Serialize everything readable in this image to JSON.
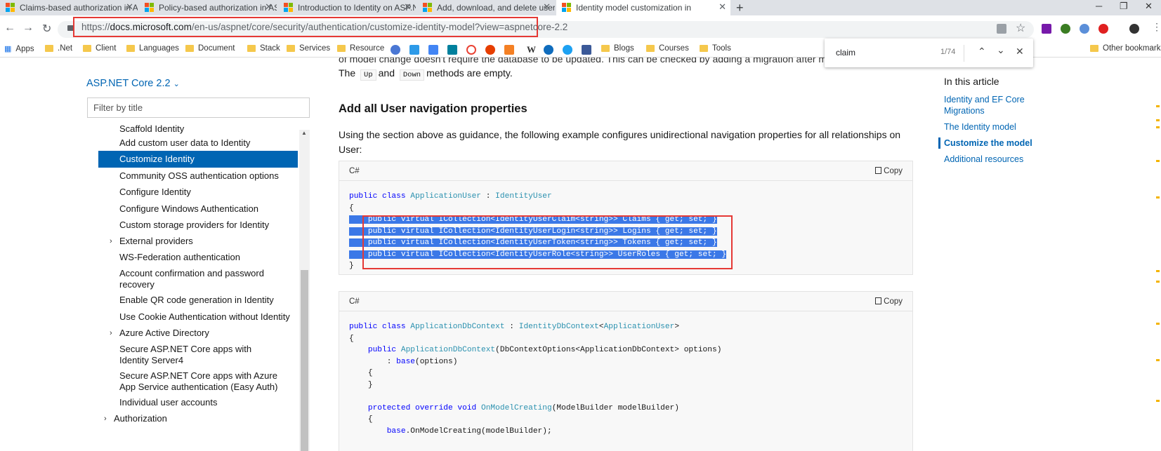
{
  "tabs": [
    {
      "title": "Claims-based authorization in AS"
    },
    {
      "title": "Policy-based authorization in AS"
    },
    {
      "title": "Introduction to Identity on ASP.N"
    },
    {
      "title": "Add, download, and delete user"
    },
    {
      "title": "Identity model customization in"
    }
  ],
  "url": {
    "prefix": "https://",
    "host": "docs.microsoft.com",
    "path": "/en-us/aspnet/core/security/authentication/customize-identity-model?view=aspnetcore-2.2"
  },
  "bookmarks": {
    "apps": "Apps",
    "folders": [
      ".Net",
      "Client",
      "Languages",
      "Document",
      "Stack",
      "Services",
      "Resource"
    ],
    "folders2": [
      "Blogs",
      "Courses",
      "Tools"
    ],
    "other": "Other bookmarks"
  },
  "find": {
    "query": "claim",
    "count": "1/74"
  },
  "nav": {
    "version": "ASP.NET Core 2.2",
    "filter_placeholder": "Filter by title",
    "items": [
      {
        "label": "Scaffold Identity"
      },
      {
        "label": "Add custom user data to Identity"
      },
      {
        "label": "Customize Identity"
      },
      {
        "label": "Community OSS authentication options"
      },
      {
        "label": "Configure Identity"
      },
      {
        "label": "Configure Windows Authentication"
      },
      {
        "label": "Custom storage providers for Identity"
      },
      {
        "label": "External providers"
      },
      {
        "label": "WS-Federation authentication"
      },
      {
        "label": "Account confirmation and password recovery"
      },
      {
        "label": "Enable QR code generation in Identity"
      },
      {
        "label": "Use Cookie Authentication without Identity"
      },
      {
        "label": "Azure Active Directory"
      },
      {
        "label": "Secure ASP.NET Core apps with Identity Server4"
      },
      {
        "label": "Secure ASP.NET Core apps with Azure App Service authentication (Easy Auth)"
      },
      {
        "label": "Individual user accounts"
      },
      {
        "label": "Authorization"
      }
    ]
  },
  "content": {
    "partial_line": "of model change doesn't require the database to be updated. This can be checked by adding a migration after m",
    "methods_pre": "The",
    "methods_up": "Up",
    "methods_and": "and",
    "methods_down": "Down",
    "methods_post": "methods are empty.",
    "heading": "Add all User navigation properties",
    "intro": "Using the section above as guidance, the following example configures unidirectional navigation properties for all relationships on User:",
    "code_lang": "C#",
    "copy_label": "Copy"
  },
  "right_toc": {
    "heading": "In this article",
    "links": [
      {
        "label": "Identity and EF Core Migrations"
      },
      {
        "label": "The Identity model"
      },
      {
        "label": "Customize the model"
      },
      {
        "label": "Additional resources"
      }
    ]
  }
}
